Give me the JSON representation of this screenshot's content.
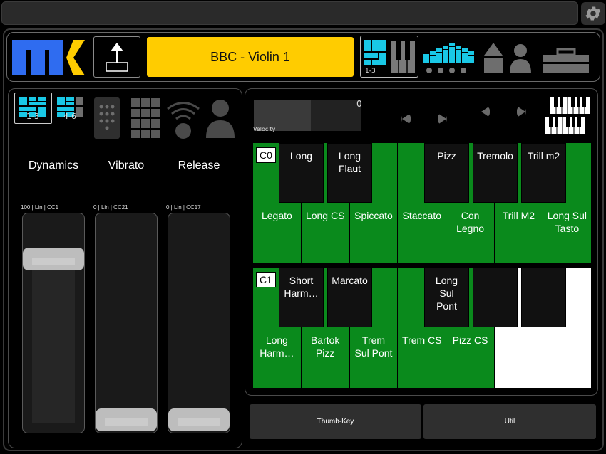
{
  "header": {
    "patch_name": "BBC - Violin 1",
    "selected_mode_label": "1-3"
  },
  "left_panel": {
    "group_buttons": [
      {
        "label": "1-3",
        "selected": true
      },
      {
        "label": "4-6",
        "selected": false
      }
    ],
    "columns": [
      {
        "title": "Dynamics",
        "meta": "100 | Lin | CC1",
        "value_fraction": 0.83
      },
      {
        "title": "Vibrato",
        "meta": "0 | Lin | CC21",
        "value_fraction": 0.0
      },
      {
        "title": "Release",
        "meta": "0 | Lin | CC17",
        "value_fraction": 0.0
      }
    ]
  },
  "velocity": {
    "label": "Velocity",
    "value": "0",
    "fill_fraction": 0.53
  },
  "keyboard": {
    "rows": [
      {
        "octave": "C0",
        "white_keys": [
          "Legato",
          "Long CS",
          "Spiccato",
          "Staccato",
          "Con\nLegno",
          "Trill M2",
          "Long Sul\nTasto"
        ],
        "black_keys": [
          "Long",
          "Long\nFlaut",
          "Pizz",
          "Tremolo",
          "Trill m2"
        ]
      },
      {
        "octave": "C1",
        "white_keys": [
          "Long\nHarm…",
          "Bartok\nPizz",
          "Trem\nSul Pont",
          "Trem CS",
          "Pizz CS",
          "",
          ""
        ],
        "black_keys": [
          "Short\nHarm…",
          "Marcato",
          "Long\nSul\nPont",
          "",
          ""
        ]
      }
    ]
  },
  "bottom_buttons": [
    "Thumb-Key",
    "Util"
  ],
  "colors": {
    "accent_cyan": "#19c8e6",
    "patch_yellow": "#ffcc00",
    "key_green": "#0a8a1c",
    "logo_blue": "#2f6cf0"
  }
}
